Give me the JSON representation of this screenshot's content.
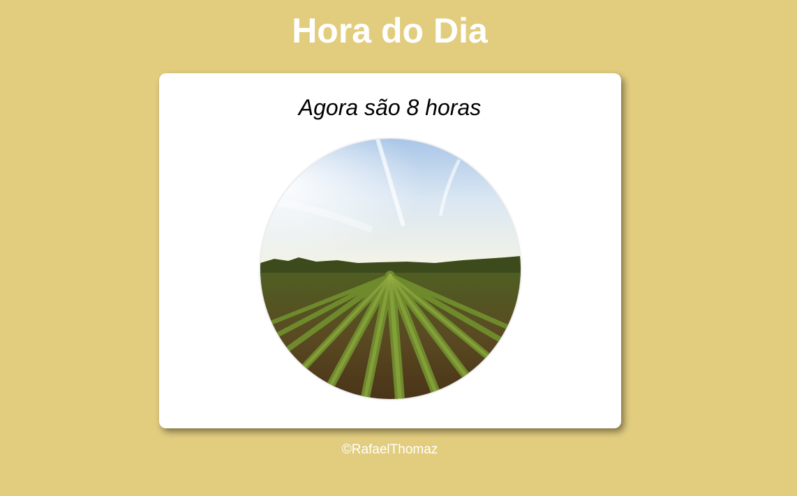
{
  "header": {
    "title": "Hora do Dia"
  },
  "main": {
    "message": "Agora são 8 horas",
    "image": {
      "icon": "field-morning-icon"
    }
  },
  "footer": {
    "copyright": "©RafaelThomaz"
  },
  "colors": {
    "background": "#e2cd7f",
    "card": "#ffffff",
    "title": "#ffffff"
  }
}
